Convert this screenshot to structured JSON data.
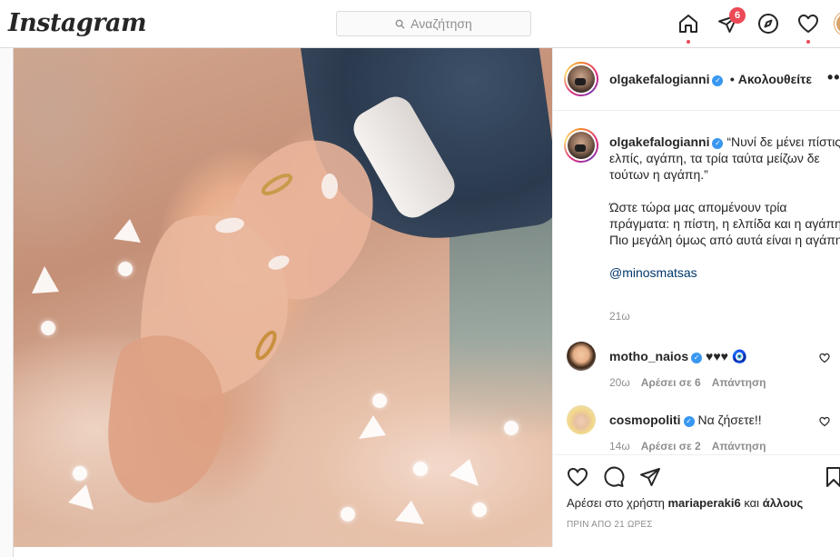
{
  "topbar": {
    "logo": "Instagram",
    "search_placeholder": "Αναζήτηση",
    "notifications_count": "6",
    "icons": [
      "home-icon",
      "direct-icon",
      "explore-icon",
      "activity-heart-icon"
    ]
  },
  "post": {
    "author": {
      "username": "olgakefalogianni",
      "follow_label": "• Ακολουθείτε",
      "more_label": "•••"
    },
    "caption": {
      "username": "olgakefalogianni",
      "line1": "“Νυνί δε μένει πίστις, ελπίς, αγάπη, τα τρία ταύτα μείζων δε τούτων η αγάπη.”",
      "line2": "Ώστε τώρα μας απομένουν τρία πράγματα: η πίστη, η ελπίδα και η αγάπη. Πιο μεγάλη όμως από αυτά είναι η αγάπη.",
      "mention": "@minosmatsas",
      "time": "21ω"
    },
    "comments": [
      {
        "username": "motho_naios",
        "text": "♥♥♥",
        "emoji": "🧿",
        "time": "20ω",
        "likes": "Αρέσει σε 6",
        "reply": "Απάντηση"
      },
      {
        "username": "cosmopoliti",
        "text": "Να ζήσετε!!",
        "time": "14ω",
        "likes": "Αρέσει σε 2",
        "reply": "Απάντηση"
      }
    ],
    "likes_prefix": "Αρέσει στο χρήστη",
    "likes_user": "mariaperaki6",
    "likes_and": "και",
    "likes_others": "άλλους",
    "posted_ago": "ΠΡΙΝ ΑΠΟ 21 ΩΡΕΣ"
  },
  "colors": {
    "accent": "#3897f0",
    "badge": "#ed4956",
    "link": "#00376b",
    "muted": "#8e8e8e"
  }
}
